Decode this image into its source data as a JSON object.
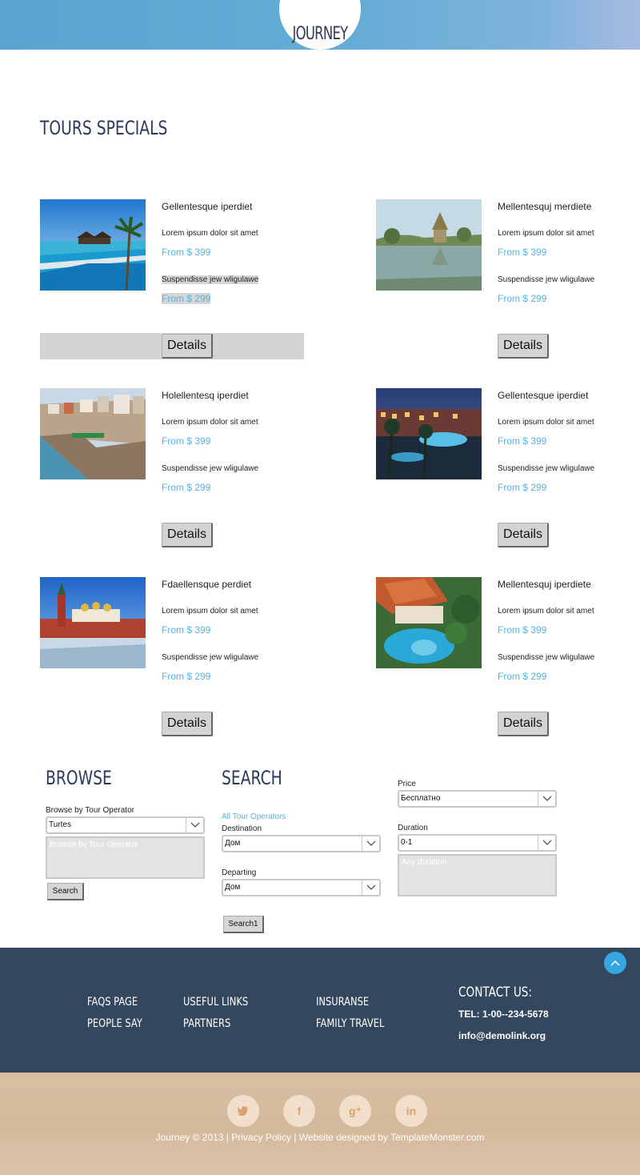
{
  "header": {
    "logo": "JOURNEY"
  },
  "page_title": "TOURS SPECIALS",
  "tours": [
    {
      "title": "Gellentesque iperdiet",
      "line1": "Lorem ipsum dolor sit amet",
      "price1": "From $ 399",
      "line2": "Suspendisse jew wligulawe",
      "price2": "From $ 299",
      "button": "Details"
    },
    {
      "title": "Mellentesquj merdiete",
      "line1": "Lorem ipsum dolor sit amet",
      "price1": "From $ 399",
      "line2": "Suspendisse jew wligulawe",
      "price2": "From $ 299",
      "button": "Details"
    },
    {
      "title": "Holellentesq iperdiet",
      "line1": "Lorem ipsum dolor sit amet",
      "price1": "From $ 399",
      "line2": "Suspendisse jew wligulawe",
      "price2": "From $ 299",
      "button": "Details"
    },
    {
      "title": "Gellentesque iperdiet",
      "line1": "Lorem ipsum dolor sit amet",
      "price1": "From $ 399",
      "line2": "Suspendisse jew wligulawe",
      "price2": "From $ 299",
      "button": "Details"
    },
    {
      "title": "Fdaellensque perdiet",
      "line1": "Lorem ipsum dolor sit amet",
      "price1": "From $ 399",
      "line2": "Suspendisse jew wligulawe",
      "price2": "From $ 299",
      "button": "Details"
    },
    {
      "title": "Mellentesquj iperdiete",
      "line1": "Lorem ipsum dolor sit amet",
      "price1": "From $ 399",
      "line2": "Suspendisse jew wligulawe",
      "price2": "From $ 299",
      "button": "Details"
    }
  ],
  "browse": {
    "title": "BROWSE",
    "label": "Browse by Tour Operator",
    "select_value": "Turtes",
    "textarea_placeholder": "Browse by Tour Operator",
    "button": "Search"
  },
  "search": {
    "title": "SEARCH",
    "all_operators_link": "All Tour Operators",
    "destination_label": "Destination",
    "destination_value": "Дом",
    "departing_label": "Departing",
    "departing_value": "Дом",
    "button": "Search1",
    "price_label": "Price",
    "price_value": "Бесплатно",
    "duration_label": "Duration",
    "duration_value": "0-1",
    "duration_textarea_placeholder": "Any duration"
  },
  "footer": {
    "links": [
      "FAQS PAGE",
      "PEOPLE SAY",
      "USEFUL LINKS",
      "PARTNERS",
      "INSURANSE",
      "FAMILY TRAVEL"
    ],
    "contact_title": "CONTACT US:",
    "tel": "TEL: 1-00--234-5678",
    "email": "info@demolink.org"
  },
  "bottom": {
    "social_icons": [
      "twitter-icon",
      "facebook-icon",
      "google-plus-icon",
      "linkedin-icon"
    ],
    "copyright": "Journey © 2013 | Privacy Policy | Website designed by TemplateMonster.com"
  },
  "colors": {
    "accent": "#5ab0e0",
    "heading": "#2b3a5c",
    "footer_bg": "#33475e",
    "bottom_bg": "#d6bc9f"
  }
}
